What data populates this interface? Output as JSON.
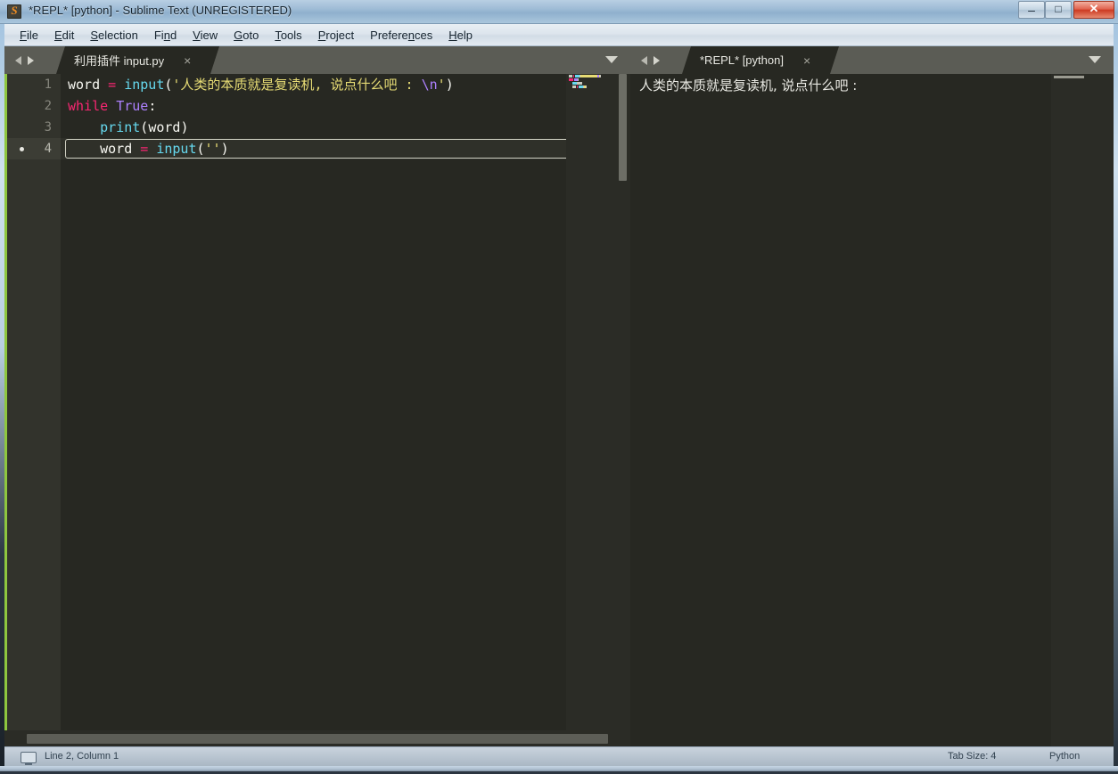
{
  "window": {
    "title": "*REPL* [python] - Sublime Text (UNREGISTERED)",
    "app_icon": "sublime-text-icon",
    "controls": {
      "minimize": "minimize-icon",
      "maximize": "maximize-icon",
      "close": "close-icon"
    }
  },
  "menubar": {
    "items": [
      {
        "label": "File",
        "mnemonic": "F"
      },
      {
        "label": "Edit",
        "mnemonic": "E"
      },
      {
        "label": "Selection",
        "mnemonic": "S"
      },
      {
        "label": "Find",
        "mnemonic": "n"
      },
      {
        "label": "View",
        "mnemonic": "V"
      },
      {
        "label": "Goto",
        "mnemonic": "G"
      },
      {
        "label": "Tools",
        "mnemonic": "T"
      },
      {
        "label": "Project",
        "mnemonic": "P"
      },
      {
        "label": "Preferences",
        "mnemonic": "n"
      },
      {
        "label": "Help",
        "mnemonic": "H"
      }
    ]
  },
  "panes": {
    "left": {
      "tab": {
        "label": "利用插件 input.py",
        "close_label": "×"
      },
      "nav_prev_icon": "chevron-left-icon",
      "nav_next_icon": "chevron-right-icon",
      "tab_menu_icon": "chevron-down-icon",
      "code": {
        "lines": [
          {
            "number": "1",
            "active": false,
            "bullet": false,
            "tokens": [
              {
                "t": "word",
                "c": "pun"
              },
              {
                "t": " ",
                "c": "pun"
              },
              {
                "t": "=",
                "c": "op"
              },
              {
                "t": " ",
                "c": "pun"
              },
              {
                "t": "input",
                "c": "fn"
              },
              {
                "t": "(",
                "c": "pun"
              },
              {
                "t": "'人类的本质就是复读机, 说点什么吧 : ",
                "c": "str"
              },
              {
                "t": "\\n",
                "c": "esc"
              },
              {
                "t": "'",
                "c": "str"
              },
              {
                "t": ")",
                "c": "pun"
              }
            ]
          },
          {
            "number": "2",
            "active": false,
            "bullet": false,
            "tokens": [
              {
                "t": "while",
                "c": "kw"
              },
              {
                "t": " ",
                "c": "pun"
              },
              {
                "t": "True",
                "c": "cst"
              },
              {
                "t": ":",
                "c": "pun"
              }
            ]
          },
          {
            "number": "3",
            "active": false,
            "bullet": false,
            "tokens": [
              {
                "t": "    ",
                "c": "pun"
              },
              {
                "t": "print",
                "c": "fn"
              },
              {
                "t": "(",
                "c": "pun"
              },
              {
                "t": "word",
                "c": "pun"
              },
              {
                "t": ")",
                "c": "pun"
              }
            ]
          },
          {
            "number": "4",
            "active": true,
            "bullet": true,
            "tokens": [
              {
                "t": "    ",
                "c": "pun"
              },
              {
                "t": "word",
                "c": "pun"
              },
              {
                "t": " ",
                "c": "pun"
              },
              {
                "t": "=",
                "c": "op"
              },
              {
                "t": " ",
                "c": "pun"
              },
              {
                "t": "input",
                "c": "fn"
              },
              {
                "t": "(",
                "c": "pun"
              },
              {
                "t": "''",
                "c": "str"
              },
              {
                "t": ")",
                "c": "pun"
              }
            ]
          }
        ]
      }
    },
    "right": {
      "tab": {
        "label": "*REPL* [python]",
        "close_label": "×"
      },
      "nav_prev_icon": "chevron-left-icon",
      "nav_next_icon": "chevron-right-icon",
      "tab_menu_icon": "chevron-down-icon",
      "output": "人类的本质就是复读机, 说点什么吧 :"
    }
  },
  "statusbar": {
    "monitor_icon": "monitor-icon",
    "line_column": "Line 2, Column 1",
    "tab_size": "Tab Size: 4",
    "syntax": "Python"
  },
  "colors": {
    "editor_bg": "#272822",
    "gutter_bg": "#32332c",
    "accent_green": "#8ec63f",
    "keyword": "#f92672",
    "constant": "#ae81ff",
    "function": "#66d9ef",
    "string": "#e6db74",
    "foreground": "#f8f8f2",
    "tabbar_bg": "#5b5c55",
    "close_button": "#cc3a22"
  }
}
